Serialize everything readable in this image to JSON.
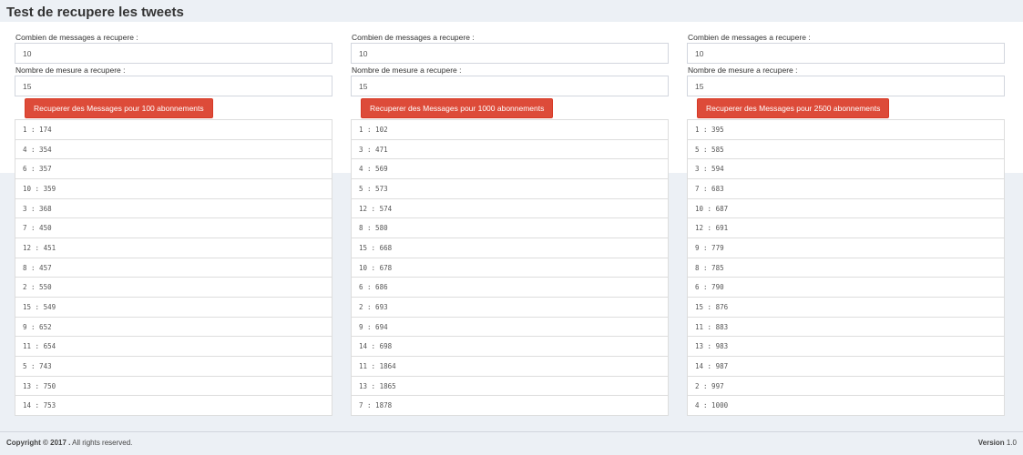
{
  "page": {
    "title": "Test de recupere les tweets"
  },
  "columns": [
    {
      "messages_label": "Combien de messages a recupere :",
      "messages_value": "10",
      "measures_label": "Nombre de mesure a recupere :",
      "measures_value": "15",
      "button_label": "Recuperer des Messages pour 100 abonnements",
      "results": [
        "1 : 174",
        "4 : 354",
        "6 : 357",
        "10 : 359",
        "3 : 368",
        "7 : 450",
        "12 : 451",
        "8 : 457",
        "2 : 550",
        "15 : 549",
        "9 : 652",
        "11 : 654",
        "5 : 743",
        "13 : 750",
        "14 : 753"
      ]
    },
    {
      "messages_label": "Combien de messages a recupere :",
      "messages_value": "10",
      "measures_label": "Nombre de mesure a recupere :",
      "measures_value": "15",
      "button_label": "Recuperer des Messages pour 1000 abonnements",
      "results": [
        "1 : 102",
        "3 : 471",
        "4 : 569",
        "5 : 573",
        "12 : 574",
        "8 : 580",
        "15 : 668",
        "10 : 678",
        "6 : 686",
        "2 : 693",
        "9 : 694",
        "14 : 698",
        "11 : 1864",
        "13 : 1865",
        "7 : 1878"
      ]
    },
    {
      "messages_label": "Combien de messages a recupere :",
      "messages_value": "10",
      "measures_label": "Nombre de mesure a recupere :",
      "measures_value": "15",
      "button_label": "Recuperer des Messages pour 2500 abonnements",
      "results": [
        "1 : 395",
        "5 : 585",
        "3 : 594",
        "7 : 683",
        "10 : 687",
        "12 : 691",
        "9 : 779",
        "8 : 785",
        "6 : 790",
        "15 : 876",
        "11 : 883",
        "13 : 983",
        "14 : 987",
        "2 : 997",
        "4 : 1000"
      ]
    }
  ],
  "footer": {
    "copyright": "Copyright © 2017 .",
    "rights": "All rights reserved.",
    "version_label": "Version",
    "version_value": "1.0"
  },
  "colors": {
    "button": "#dd4b39",
    "background": "#ecf0f5"
  }
}
